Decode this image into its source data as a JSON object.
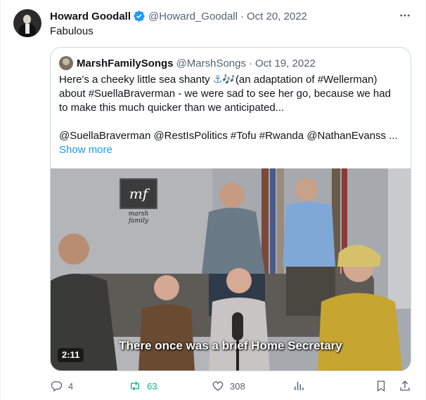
{
  "tweet": {
    "author": {
      "display_name": "Howard Goodall",
      "handle": "@Howard_Goodall",
      "verified": true,
      "verified_color": "#1d9bf0"
    },
    "separator": "·",
    "date": "Oct 20, 2022",
    "text": "Fabulous",
    "more_icon": "more-horizontal-icon"
  },
  "quote": {
    "author": {
      "display_name": "MarshFamilySongs",
      "handle": "@MarshSongs"
    },
    "separator": "·",
    "date": "Oct 19, 2022",
    "line1_a": "Here's a cheeky little sea shanty ",
    "line1_emoji": "⚓🎶",
    "line1_b": "(an adaptation of #Wellerman)",
    "line2": "about #SuellaBraverman - we were sad to see her go, because we had",
    "line3": "to make this much quicker than we anticipated...",
    "line4": "@SuellaBraverman @RestIsPolitics #Tofu #Rwanda @NathanEvanss ...",
    "show_more": "Show more",
    "video": {
      "duration": "2:11",
      "caption": "There once was a brief Home Secretary",
      "logo_text": "mf",
      "logo_sub": "marsh family"
    }
  },
  "actions": {
    "reply_count": "4",
    "retweet_count": "63",
    "like_count": "308",
    "retweet_color": "#00ba7c",
    "icons": [
      "reply-icon",
      "retweet-icon",
      "like-icon",
      "views-icon",
      "bookmark-icon",
      "share-icon"
    ]
  }
}
